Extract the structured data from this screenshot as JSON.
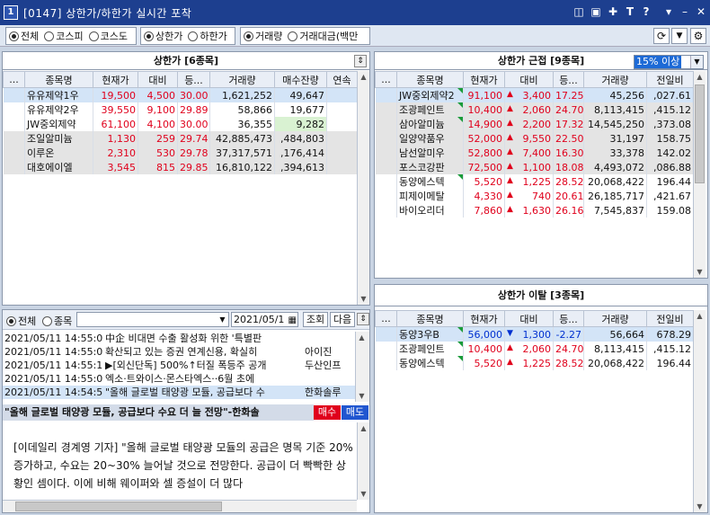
{
  "window": {
    "badge": "1",
    "title": "[0147] 상한가/하한가 실시간 포착"
  },
  "toolbar": {
    "market": [
      "전체",
      "코스피",
      "코스도"
    ],
    "limit": [
      "상한가",
      "하한가"
    ],
    "sort": "거래량",
    "sort2": "거래대금(백만"
  },
  "upper": {
    "title": "상한가 [6종목]",
    "headers": [
      "...",
      "종목명",
      "현재가",
      "대비",
      "등...",
      "거래량",
      "매수잔량",
      "연속"
    ],
    "rows": [
      [
        "",
        "유유제약1우",
        "19,500",
        "4,500",
        "30.00",
        "1,621,252",
        "49,647",
        ""
      ],
      [
        "",
        "유유제약2우",
        "39,550",
        "9,100",
        "29.89",
        "58,866",
        "19,677",
        ""
      ],
      [
        "",
        "JW중외제약",
        "61,100",
        "4,100",
        "30.00",
        "36,355",
        "9,282",
        ""
      ],
      [
        "",
        "조일알미늄",
        "1,130",
        "259",
        "29.74",
        "42,885,473",
        ",484,803",
        ""
      ],
      [
        "",
        "이루온",
        "2,310",
        "530",
        "29.78",
        "37,317,571",
        ",176,414",
        ""
      ],
      [
        "",
        "대호에이엘",
        "3,545",
        "815",
        "29.85",
        "16,810,122",
        ",394,613",
        ""
      ]
    ]
  },
  "near": {
    "title": "상한가 근접 [9종목]",
    "filter": "15% 이상",
    "headers": [
      "...",
      "종목명",
      "현재가",
      "대비",
      "등...",
      "거래량",
      "전일비"
    ],
    "rows": [
      [
        "",
        "JW중외제약2",
        "91,100",
        "3,400",
        "17.25",
        "45,256",
        ",027.61"
      ],
      [
        "",
        "조광페인트",
        "10,400",
        "2,060",
        "24.70",
        "8,113,415",
        ",415.12"
      ],
      [
        "",
        "삼아알미늄",
        "14,900",
        "2,200",
        "17.32",
        "14,545,250",
        ",373.08"
      ],
      [
        "",
        "일양약품우",
        "52,000",
        "9,550",
        "22.50",
        "31,197",
        "158.75"
      ],
      [
        "",
        "남선알미우",
        "52,800",
        "7,400",
        "16.30",
        "33,378",
        "142.02"
      ],
      [
        "",
        "포스코강판",
        "72,500",
        "1,100",
        "18.08",
        "4,493,072",
        ",086.88"
      ],
      [
        "",
        "동양에스텍",
        "5,520",
        "1,225",
        "28.52",
        "20,068,422",
        "196.44"
      ],
      [
        "",
        "피제이메탈",
        "4,330",
        "740",
        "20.61",
        "26,185,717",
        ",421.67"
      ],
      [
        "",
        "바이오리더",
        "7,860",
        "1,630",
        "26.16",
        "7,545,837",
        "159.08"
      ]
    ]
  },
  "away": {
    "title": "상한가 이탈 [3종목]",
    "headers": [
      "...",
      "종목명",
      "현재가",
      "대비",
      "등...",
      "거래량",
      "전일비"
    ],
    "rows": [
      [
        "",
        "동양3우B",
        "56,000",
        "1,300",
        "-2.27",
        "56,664",
        "678.29"
      ],
      [
        "",
        "조광페인트",
        "10,400",
        "2,060",
        "24.70",
        "8,113,415",
        ",415.12"
      ],
      [
        "",
        "동양에스텍",
        "5,520",
        "1,225",
        "28.52",
        "20,068,422",
        "196.44"
      ]
    ]
  },
  "news": {
    "filter": [
      "전체",
      "종목"
    ],
    "date": "2021/05/1",
    "query": "조회",
    "next": "다음",
    "rows": [
      [
        "2021/05/11 14:55:0",
        "中企 비대면 수출 활성화 위한 '특별판",
        ""
      ],
      [
        "2021/05/11 14:55:0",
        "확산되고 있는 증권 연계신용, 확실히",
        "아이진"
      ],
      [
        "2021/05/11 14:55:1",
        "▶[외신단독] 500%↑터질 폭등주 공개",
        "두산인프"
      ],
      [
        "2021/05/11 14:55:0",
        "엑소·트와이스·몬스타엑스··6월 초에",
        ""
      ],
      [
        "2021/05/11 14:54:5",
        "\"올해 글로벌 태양광 모듈, 공급보다 수",
        "한화솔루"
      ]
    ],
    "headline": "\"올해 글로벌 태양광 모듈, 공급보다 수요 더 늘 전망\"-한화솔",
    "buy": "매수",
    "sell": "매도",
    "body": "[이데일리 경계영 기자] \"올해 글로벌 태양광 모듈의 공급은 명목 기준 20% 증가하고, 수요는 20~30% 늘어날 것으로 전망한다. 공급이 더 빡빡한 상황인 셈이다. 이에 비해 웨이퍼와 셀 증설이 더 많다"
  },
  "colors": {
    "up": "#e0001c",
    "down": "#0030d0",
    "title_bg": "#1d3f8f"
  }
}
